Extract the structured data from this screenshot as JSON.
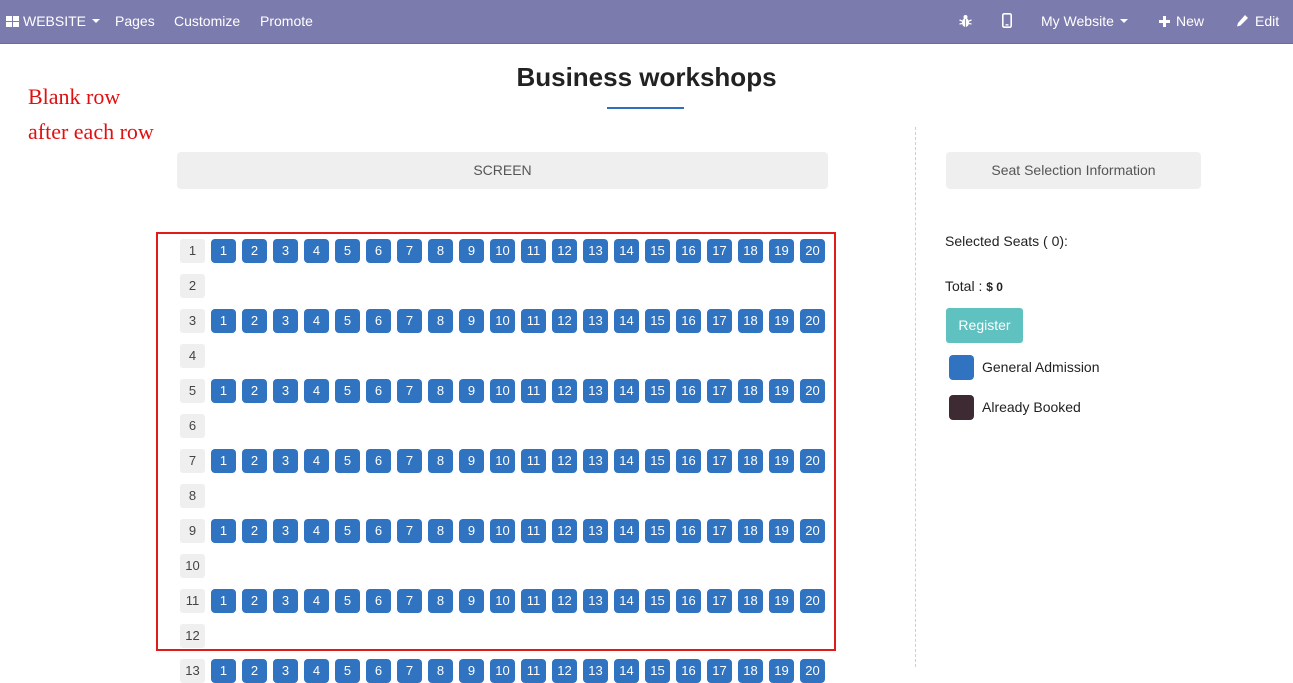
{
  "navbar": {
    "website_menu": "WEBSITE",
    "pages": "Pages",
    "customize": "Customize",
    "promote": "Promote",
    "debug_icon": "bug-icon",
    "mobile_icon": "mobile-icon",
    "my_website": "My Website",
    "new": "New",
    "edit": "Edit",
    "bg_color": "#7c7bad"
  },
  "page": {
    "title": "Business workshops"
  },
  "annotation": {
    "line1": "Blank row",
    "line2": "after each row",
    "color": "#e01010"
  },
  "screen_label": "SCREEN",
  "seat_map": {
    "rows": [
      {
        "label": "1",
        "seats": [
          "1",
          "2",
          "3",
          "4",
          "5",
          "6",
          "7",
          "8",
          "9",
          "10",
          "11",
          "12",
          "13",
          "14",
          "15",
          "16",
          "17",
          "18",
          "19",
          "20"
        ]
      },
      {
        "label": "2",
        "seats": []
      },
      {
        "label": "3",
        "seats": [
          "1",
          "2",
          "3",
          "4",
          "5",
          "6",
          "7",
          "8",
          "9",
          "10",
          "11",
          "12",
          "13",
          "14",
          "15",
          "16",
          "17",
          "18",
          "19",
          "20"
        ]
      },
      {
        "label": "4",
        "seats": []
      },
      {
        "label": "5",
        "seats": [
          "1",
          "2",
          "3",
          "4",
          "5",
          "6",
          "7",
          "8",
          "9",
          "10",
          "11",
          "12",
          "13",
          "14",
          "15",
          "16",
          "17",
          "18",
          "19",
          "20"
        ]
      },
      {
        "label": "6",
        "seats": []
      },
      {
        "label": "7",
        "seats": [
          "1",
          "2",
          "3",
          "4",
          "5",
          "6",
          "7",
          "8",
          "9",
          "10",
          "11",
          "12",
          "13",
          "14",
          "15",
          "16",
          "17",
          "18",
          "19",
          "20"
        ]
      },
      {
        "label": "8",
        "seats": []
      },
      {
        "label": "9",
        "seats": [
          "1",
          "2",
          "3",
          "4",
          "5",
          "6",
          "7",
          "8",
          "9",
          "10",
          "11",
          "12",
          "13",
          "14",
          "15",
          "16",
          "17",
          "18",
          "19",
          "20"
        ]
      },
      {
        "label": "10",
        "seats": []
      },
      {
        "label": "11",
        "seats": [
          "1",
          "2",
          "3",
          "4",
          "5",
          "6",
          "7",
          "8",
          "9",
          "10",
          "11",
          "12",
          "13",
          "14",
          "15",
          "16",
          "17",
          "18",
          "19",
          "20"
        ]
      },
      {
        "label": "12",
        "seats": []
      },
      {
        "label": "13",
        "seats": [
          "1",
          "2",
          "3",
          "4",
          "5",
          "6",
          "7",
          "8",
          "9",
          "10",
          "11",
          "12",
          "13",
          "14",
          "15",
          "16",
          "17",
          "18",
          "19",
          "20"
        ]
      }
    ],
    "available_color": "#2f73c1"
  },
  "sidebar": {
    "header": "Seat Selection Information",
    "selected_seats": "Selected Seats ( 0):",
    "total_label": "Total : ",
    "total_value": "$ 0",
    "register": "Register",
    "legend": [
      {
        "label": "General Admission",
        "color": "#2f73c1"
      },
      {
        "label": "Already Booked",
        "color": "#3e2a33"
      }
    ]
  }
}
